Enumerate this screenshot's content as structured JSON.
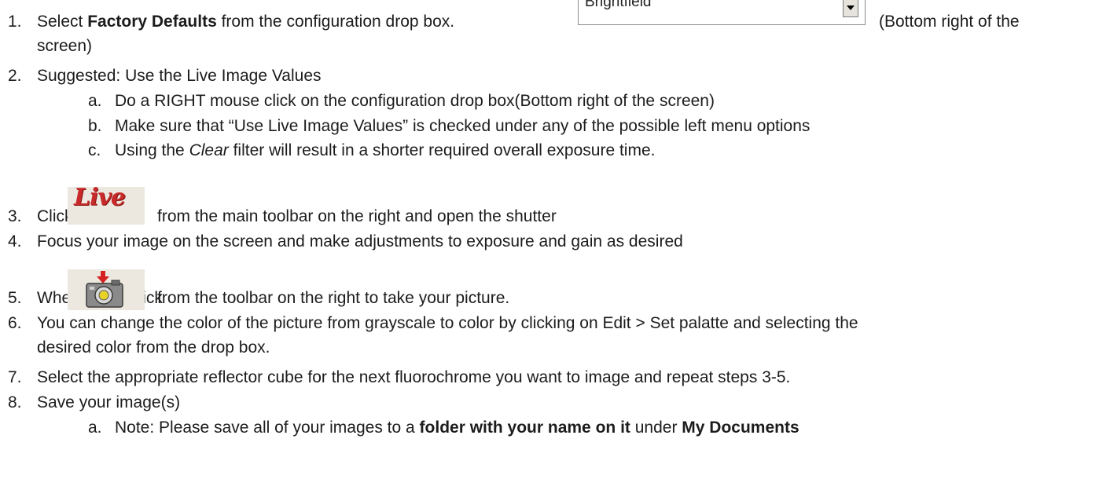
{
  "steps": [
    {
      "n": "1.",
      "pre": "Select ",
      "bold": "Factory Defaults",
      "post": " from the configuration drop box.",
      "after": "(Bottom right of the",
      "cont": "screen)"
    },
    {
      "n": "2.",
      "text": "Suggested:  Use the Live Image Values"
    },
    {
      "n": "3.",
      "pre": "Click",
      "post": "from the main toolbar on the right and open the shutter"
    },
    {
      "n": "4.",
      "text": "Focus your image on the screen and make adjustments to exposure and gain as desired"
    },
    {
      "n": "5.",
      "pre": "When ready click",
      "post": "from the toolbar on the right to take your picture."
    },
    {
      "n": "6.",
      "text": "You can change the color of the picture from grayscale to color by clicking on Edit > Set palatte and selecting the",
      "cont": "desired color from the drop box."
    },
    {
      "n": "7.",
      "text": "Select the appropriate reflector cube for the next fluorochrome you want to image and repeat steps 3-5."
    },
    {
      "n": "8.",
      "text": "Save your image(s)"
    }
  ],
  "substeps2": [
    {
      "l": "a.",
      "text": "Do a RIGHT mouse click on the  configuration drop box(Bottom right of the screen)"
    },
    {
      "l": "b.",
      "text": "Make sure that “Use Live Image Values” is checked under any of the possible left menu options"
    },
    {
      "l": "c.",
      "pre": "Using the ",
      "ital": "Clear",
      "post": " filter will result in a shorter required overall exposure time."
    }
  ],
  "substeps8": [
    {
      "l": "a.",
      "pre": "Note: Please save all of your images to a ",
      "bold1": "folder with your name on it",
      "mid": " under ",
      "bold2": "My Documents"
    }
  ],
  "dropbox": {
    "value": "Brightfield"
  },
  "live_button": {
    "label": "Live"
  },
  "colors": {
    "live_red": "#c82a2a",
    "camera_arrow": "#d42020"
  },
  "icons": {
    "camera": "camera-capture-icon",
    "dropdown": "chevron-down-icon"
  }
}
